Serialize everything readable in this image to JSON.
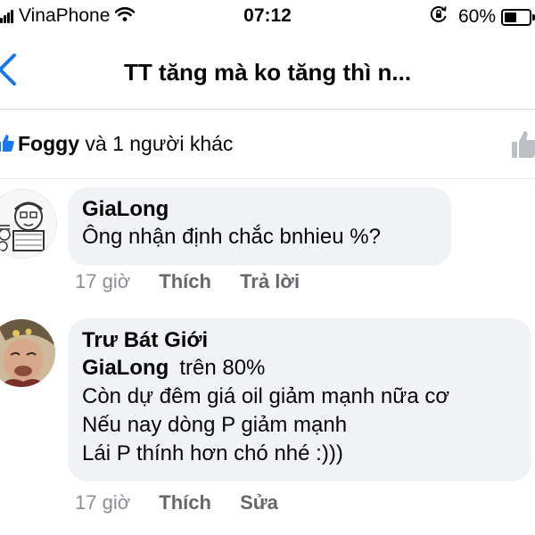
{
  "status_bar": {
    "carrier": "VinaPhone",
    "time": "07:12",
    "battery": "60%",
    "battery_level": 0.6,
    "icons": [
      "signal-icon",
      "wifi-icon",
      "orientation-lock-icon",
      "battery-icon"
    ]
  },
  "nav": {
    "title": "TT tăng mà ko tăng thì n...",
    "back_icon": "chevron-left-icon"
  },
  "reactions": {
    "name": "Foggy",
    "rest": "và 1 người khác",
    "icon": "like-icon"
  },
  "comments": [
    {
      "author": "GiaLong",
      "lines": [
        "Ông nhận định chắc bnhieu %?"
      ],
      "time": "17 giờ",
      "action1": "Thích",
      "action2": "Trả lời"
    },
    {
      "author": "Trư Bát Giới",
      "mention": "GiaLong",
      "first_line": "trên 80%",
      "lines": [
        "Còn dự đêm giá oil giảm mạnh nữa cơ",
        "Nếu nay dòng P giảm mạnh",
        "Lái P thính hơn chó nhé :)))"
      ],
      "time": "17 giờ",
      "action1": "Thích",
      "action2": "Sửa"
    }
  ],
  "colors": {
    "accent": "#1877f2",
    "bubble": "#f0f2f5",
    "meta_text": "#8a8d91",
    "divider": "#d8dadf"
  }
}
